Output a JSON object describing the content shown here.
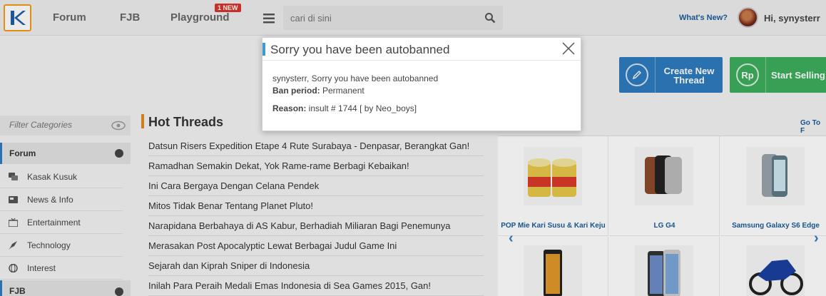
{
  "header": {
    "nav": [
      "Forum",
      "FJB",
      "Playground"
    ],
    "new_badge": "1 NEW",
    "search_placeholder": "cari di sini",
    "whats_new": "What's New?",
    "greeting": "Hi, synysterr"
  },
  "actions": {
    "create_line1": "Create New",
    "create_line2": "Thread",
    "sell": "Start Selling",
    "sell_icon": "Rp"
  },
  "sidebar": {
    "filter_placeholder": "Filter Categories",
    "forum_heading": "Forum",
    "items": [
      "Kasak Kusuk",
      "News & Info",
      "Entertainment",
      "Technology",
      "Interest"
    ],
    "fjb_heading": "FJB"
  },
  "hot_threads": {
    "title": "Hot Threads",
    "items": [
      "Datsun Risers Expedition Etape 4 Rute Surabaya - Denpasar, Berangkat Gan!",
      "Ramadhan Semakin Dekat, Yok Rame-rame Berbagi Kebaikan!",
      "Ini Cara Bergaya Dengan Celana Pendek",
      "Mitos Tidak Benar Tentang Planet Pluto!",
      "Narapidana Berbahaya di AS Kabur, Berhadiah Miliaran Bagi Penemunya",
      "Merasakan Post Apocalyptic Lewat Berbagai Judul Game Ini",
      "Sejarah dan Kiprah Sniper di Indonesia",
      "Inilah Para Peraih Medali Emas Indonesia di Sea Games 2015, Gan!"
    ]
  },
  "products": {
    "goto": "Go To F",
    "items": [
      "POP Mie Kari Susu & Kari Keju",
      "LG G4",
      "Samsung Galaxy S6 Edge"
    ]
  },
  "modal": {
    "title": "Sorry you have been autobanned",
    "message": "synysterr, Sorry you have been autobanned",
    "ban_period_label": "Ban period:",
    "ban_period_value": " Permanent",
    "reason_label": "Reason:",
    "reason_value": " insult # 1744 [ by Neo_boys]"
  }
}
